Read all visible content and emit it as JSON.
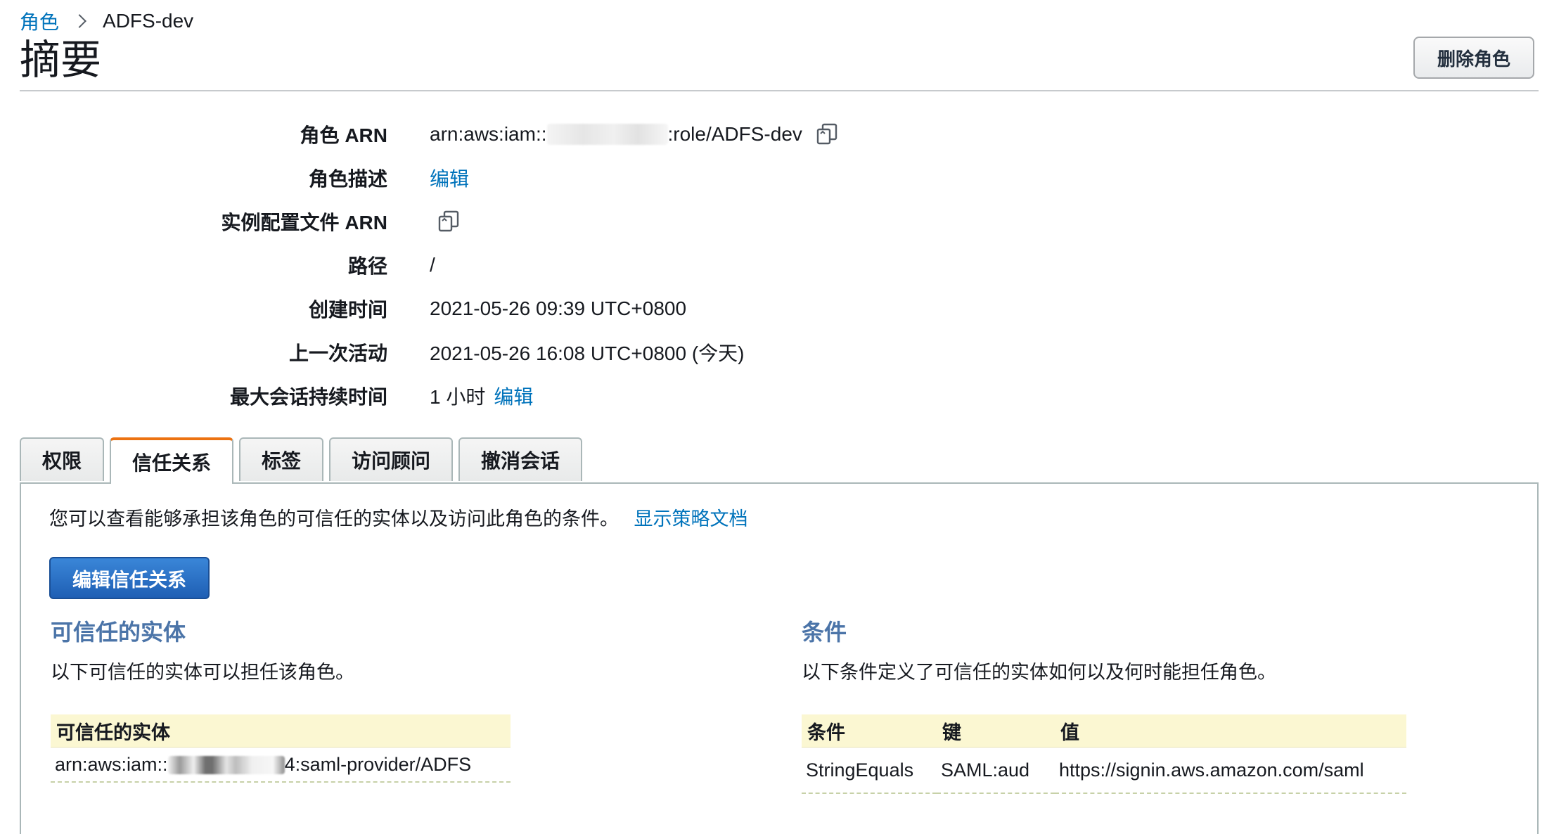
{
  "breadcrumb": {
    "parent": "角色",
    "current": "ADFS-dev"
  },
  "header": {
    "title": "摘要",
    "delete_label": "删除角色"
  },
  "summary": {
    "role_arn": {
      "label": "角色 ARN",
      "prefix": "arn:aws:iam::",
      "suffix": ":role/ADFS-dev"
    },
    "role_description": {
      "label": "角色描述",
      "edit": "编辑"
    },
    "instance_profile_arn": {
      "label": "实例配置文件 ARN"
    },
    "path": {
      "label": "路径",
      "value": "/"
    },
    "created": {
      "label": "创建时间",
      "value": "2021-05-26 09:39 UTC+0800"
    },
    "last_activity": {
      "label": "上一次活动",
      "value": "2021-05-26 16:08 UTC+0800 (今天)"
    },
    "max_session": {
      "label": "最大会话持续时间",
      "value": "1 小时",
      "edit": "编辑"
    }
  },
  "tabs": [
    {
      "label": "权限",
      "active": false
    },
    {
      "label": "信任关系",
      "active": true
    },
    {
      "label": "标签",
      "active": false
    },
    {
      "label": "访问顾问",
      "active": false
    },
    {
      "label": "撤消会话",
      "active": false
    }
  ],
  "trust": {
    "intro": "您可以查看能够承担该角色的可信任的实体以及访问此角色的条件。",
    "show_policy_link": "显示策略文档",
    "edit_button": "编辑信任关系",
    "entities": {
      "title": "可信任的实体",
      "desc": "以下可信任的实体可以担任该角色。",
      "header": "可信任的实体",
      "row_prefix": "arn:aws:iam::",
      "row_suffix": "4:saml-provider/ADFS"
    },
    "conditions": {
      "title": "条件",
      "desc": "以下条件定义了可信任的实体如何以及何时能担任角色。",
      "headers": [
        "条件",
        "键",
        "值"
      ],
      "rows": [
        [
          "StringEquals",
          "SAML:aud",
          "https://signin.aws.amazon.com/saml"
        ]
      ]
    }
  },
  "colors": {
    "link": "#0073bb",
    "tab_active_accent": "#ec7211",
    "primary_button": "#1f5fb4",
    "table_header_bg": "#fbf7d2",
    "section_title": "#4b74a8"
  }
}
